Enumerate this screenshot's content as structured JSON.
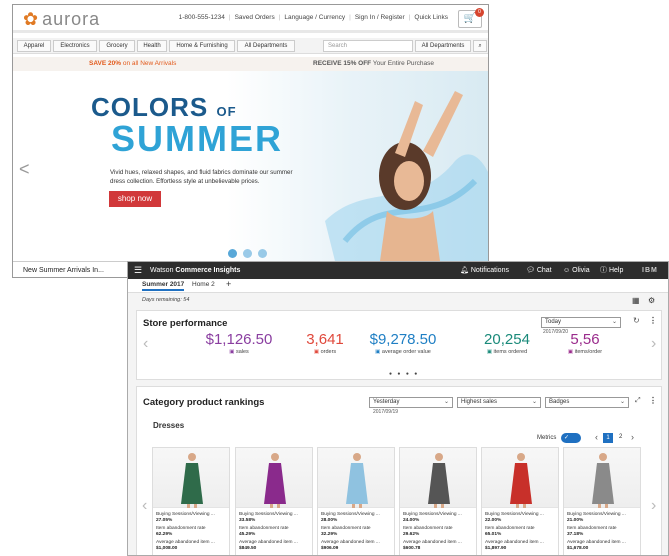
{
  "store": {
    "brand": "aurora",
    "phone": "1-800-555-1234",
    "links": [
      "Saved Orders",
      "Language / Currency",
      "Sign In / Register",
      "Quick Links"
    ],
    "cart_count": "0",
    "nav": [
      "Apparel",
      "Electronics",
      "Grocery",
      "Health",
      "Home & Furnishing",
      "All Departments"
    ],
    "search_placeholder": "Search",
    "search_scope": "All Departments",
    "promo_left_bold": "SAVE 20%",
    "promo_left_rest": " on all New Arrivals",
    "promo_right_bold": "RECEIVE 15% OFF",
    "promo_right_rest": " Your Entire Purchase",
    "hero_colors": "COLORS",
    "hero_of": "OF",
    "hero_summer": "SUMMER",
    "hero_text": "Vivid hues, relaxed shapes, and fluid fabrics dominate our summer dress collection. Effortless style at unbelievable prices.",
    "shop_now": "shop now",
    "bottom_label": "New Summer Arrivals In..."
  },
  "watson": {
    "title_light": "Watson ",
    "title_bold": "Commerce Insights",
    "notifications": "Notifications",
    "chat": "Chat",
    "user": "Olivia",
    "help": "Help",
    "ibm": "IBM",
    "tabs": [
      "Summer 2017",
      "Home 2",
      "+"
    ],
    "days_remaining": "Days remaining: 54",
    "store_perf": {
      "title": "Store performance",
      "period": "Today",
      "date": "2017/09/20",
      "metrics": [
        {
          "value": "$1,126.50",
          "label": "sales",
          "color": "#8a3ea0"
        },
        {
          "value": "3,641",
          "label": "orders",
          "color": "#e0483b"
        },
        {
          "value": "$9,278.50",
          "label": "average order value",
          "color": "#1f7fc4"
        },
        {
          "value": "20,254",
          "label": "items ordered",
          "color": "#1a8a7a"
        },
        {
          "value": "5,56",
          "label": "items/order",
          "color": "#9a2b8c"
        }
      ]
    },
    "category": {
      "title": "Category product rankings",
      "period": "Yesterday",
      "date": "2017/09/19",
      "sort": "Highest sales",
      "badges": "Badges",
      "subtitle": "Dresses",
      "metrics_label": "Metrics",
      "page_current": "1",
      "page_next": "2",
      "products": [
        {
          "sessions": "Buying Sessions/Viewing ...",
          "sess_pct": "27.05%",
          "abandon_label": "Item abandonment rate",
          "abandon": "62.29%",
          "avg_label": "Average abandoned item ...",
          "avg": "$1,008.00"
        },
        {
          "sessions": "Buying Sessions/Viewing ...",
          "sess_pct": "33.58%",
          "abandon_label": "Item abandonment rate",
          "abandon": "45.29%",
          "avg_label": "Average abandoned item ...",
          "avg": "$849.50"
        },
        {
          "sessions": "Buying Sessions/Viewing ...",
          "sess_pct": "28.00%",
          "abandon_label": "Item abandonment rate",
          "abandon": "32.29%",
          "avg_label": "Average abandoned item ...",
          "avg": "$906.09"
        },
        {
          "sessions": "Buying Sessions/Viewing ...",
          "sess_pct": "24.00%",
          "abandon_label": "Item abandonment rate",
          "abandon": "29.62%",
          "avg_label": "Average abandoned item ...",
          "avg": "$600.78"
        },
        {
          "sessions": "Buying Sessions/Viewing ...",
          "sess_pct": "22.00%",
          "abandon_label": "Item abandonment rate",
          "abandon": "65.01%",
          "avg_label": "Average abandoned item ...",
          "avg": "$1,897.90"
        },
        {
          "sessions": "Buying Sessions/Viewing ...",
          "sess_pct": "21.00%",
          "abandon_label": "Item abandonment rate",
          "abandon": "37.18%",
          "avg_label": "Average abandoned item ...",
          "avg": "$1,678.00"
        }
      ],
      "dress_colors": [
        "#2f6b4a",
        "#8a2a8c",
        "#8fc2e0",
        "#555555",
        "#c8302a",
        "#8a8a8a"
      ]
    }
  }
}
